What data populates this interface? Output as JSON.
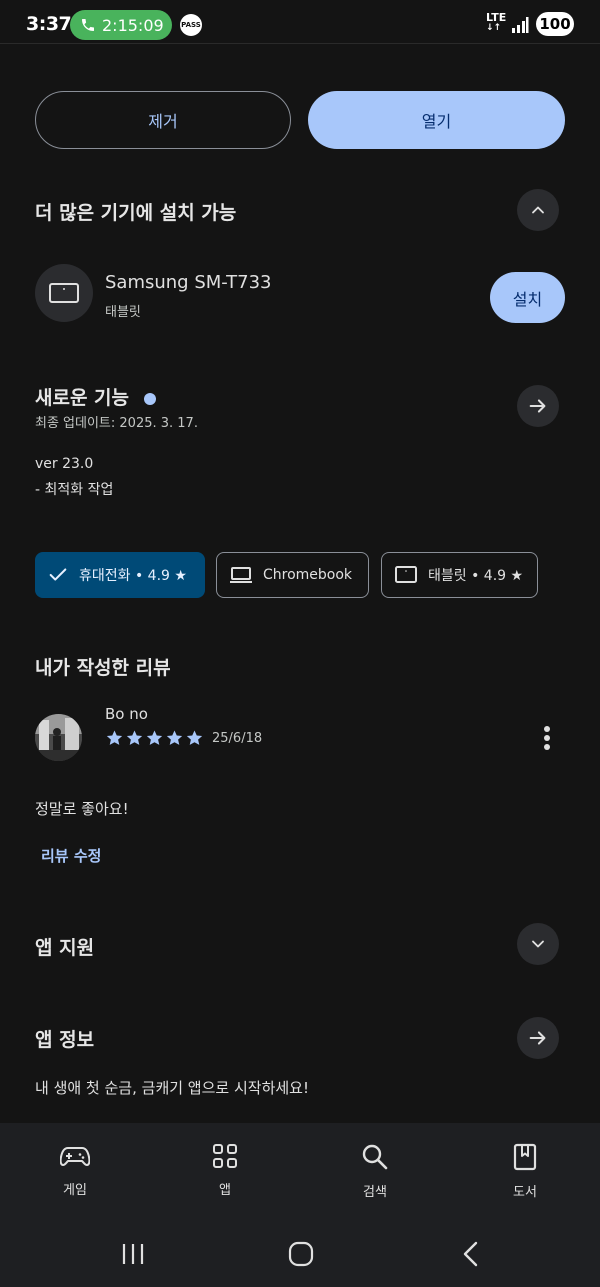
{
  "status_bar": {
    "time": "3:37",
    "call_timer": "2:15:09",
    "pass_label": "PASS",
    "network": "LTE",
    "battery": "100"
  },
  "actions": {
    "remove_label": "제거",
    "open_label": "열기"
  },
  "more_devices": {
    "title": "더 많은 기기에 설치 가능",
    "device_name": "Samsung SM-T733",
    "device_type": "태블릿",
    "install_label": "설치"
  },
  "whats_new": {
    "title": "새로운 기능",
    "updated": "최종 업데이트: 2025. 3. 17.",
    "version": "ver 23.0",
    "note": "- 최적화 작업"
  },
  "device_chips": [
    {
      "label": "휴대전화 • 4.9 ★",
      "selected": true
    },
    {
      "label": "Chromebook",
      "selected": false
    },
    {
      "label": "태블릿 • 4.9 ★",
      "selected": false
    }
  ],
  "my_review": {
    "title": "내가 작성한 리뷰",
    "author": "Bo no",
    "rating": 5,
    "date": "25/6/18",
    "body": "정말로 좋아요!",
    "edit_label": "리뷰 수정"
  },
  "app_support": {
    "title": "앱 지원"
  },
  "app_info": {
    "title": "앱 정보",
    "description": "내 생애 첫 순금, 금캐기 앱으로 시작하세요!"
  },
  "bottom_nav": [
    {
      "label": "게임",
      "icon": "gamepad-icon"
    },
    {
      "label": "앱",
      "icon": "apps-grid-icon"
    },
    {
      "label": "검색",
      "icon": "search-icon"
    },
    {
      "label": "도서",
      "icon": "book-icon"
    }
  ],
  "colors": {
    "accent": "#a8c7fa",
    "background": "#141414",
    "chip_selected": "#004a77",
    "star": "#a8c7fa",
    "call_green": "#49b35c"
  }
}
